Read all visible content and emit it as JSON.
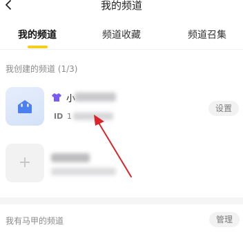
{
  "header": {
    "back_icon": "chevron-left-icon",
    "title": "我的频道"
  },
  "tabs": [
    {
      "label": "我的频道",
      "active": true
    },
    {
      "label": "频道收藏",
      "active": false
    },
    {
      "label": "频道召集",
      "active": false
    }
  ],
  "created_section": {
    "label": "我创建的频道 (1/3)",
    "channels": [
      {
        "avatar_icon": "channel-home-icon",
        "badge_icon": "shirt-badge-icon",
        "name_visible": "小",
        "id_label": "ID",
        "id_visible": "1",
        "settings_label": "设置"
      }
    ],
    "create_placeholder": {
      "icon": "plus-icon"
    }
  },
  "mine_section": {
    "label": "我有马甲的频道",
    "manage_label": "管理"
  },
  "colors": {
    "accent_indicator": "#f6cf1d",
    "annotation_arrow": "#d9252a",
    "badge_purple": "#7b5cf0",
    "avatar_icon_blue": "#4c7ff0"
  }
}
